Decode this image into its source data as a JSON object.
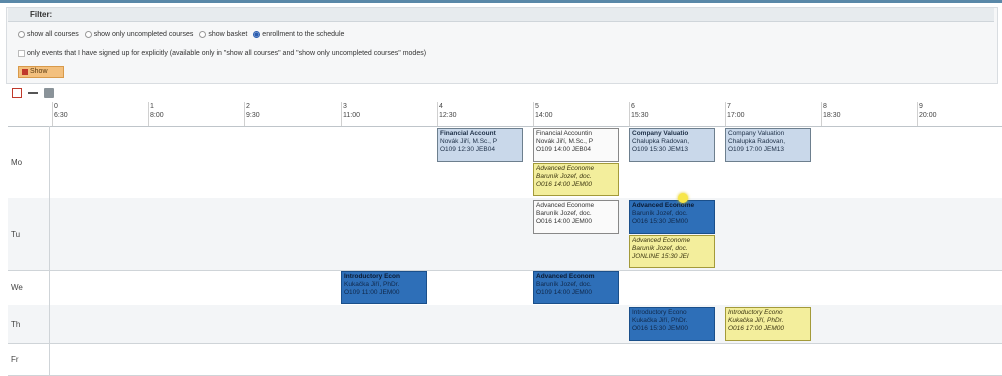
{
  "filter": {
    "title": "Filter:",
    "options": [
      {
        "label": "show all courses",
        "checked": false
      },
      {
        "label": "show only uncompleted courses",
        "checked": false
      },
      {
        "label": "show basket",
        "checked": false
      },
      {
        "label": "enrollment to the schedule",
        "checked": true
      }
    ],
    "only_events_label": "only events that I have signed up for explicitly (available only in \"show all courses\" and \"show only uncompleted courses\" modes)",
    "show_button": "Show"
  },
  "toolbar_icons": [
    "pdf-icon",
    "minus-icon",
    "print-icon"
  ],
  "timeline": [
    {
      "idx": "0",
      "time": "6:30"
    },
    {
      "idx": "1",
      "time": "8:00"
    },
    {
      "idx": "2",
      "time": "9:30"
    },
    {
      "idx": "3",
      "time": "11:00"
    },
    {
      "idx": "4",
      "time": "12:30"
    },
    {
      "idx": "5",
      "time": "14:00"
    },
    {
      "idx": "6",
      "time": "15:30"
    },
    {
      "idx": "7",
      "time": "17:00"
    },
    {
      "idx": "8",
      "time": "18:30"
    },
    {
      "idx": "9",
      "time": "20:00"
    }
  ],
  "days": [
    "Mo",
    "Tu",
    "We",
    "Th",
    "Fr"
  ],
  "events": {
    "mo_1": {
      "title": "Financial Account",
      "teacher": "Novák Jiří, M.Sc., P",
      "info": "O109 12:30 JEB04"
    },
    "mo_2": {
      "title": "Financial Accountin",
      "teacher": "Novák Jiří, M.Sc., P",
      "info": "O109 14:00 JEB04"
    },
    "mo_3": {
      "title": "Company Valuatio",
      "teacher": "Chalupka Radovan,",
      "info": "O109 15:30 JEM13"
    },
    "mo_4": {
      "title": "Company Valuation",
      "teacher": "Chalupka Radovan,",
      "info": "O109 17:00 JEM13"
    },
    "mo_5": {
      "title": "Advanced Econome",
      "teacher": "Baruník Jozef, doc.",
      "info": "O016 14:00 JEM00"
    },
    "tu_1": {
      "title": "Advanced Econome",
      "teacher": "Baruník Jozef, doc.",
      "info": "O016 14:00 JEM00"
    },
    "tu_2": {
      "title": "Advanced Econome",
      "teacher": "Baruník Jozef, doc.",
      "info": "O016 15:30 JEM00"
    },
    "tu_3": {
      "title": "Advanced Econome",
      "teacher": "Baruník Jozef, doc.",
      "info": "JONLINE 15:30 JEI"
    },
    "we_1": {
      "title": "Introductory Econ",
      "teacher": "Kukačka Jiří, PhDr.",
      "info": "O109 11:00 JEM00"
    },
    "we_2": {
      "title": "Advanced Econom",
      "teacher": "Baruník Jozef, doc.",
      "info": "O109 14:00 JEM00"
    },
    "th_1": {
      "title": "Introductory Econo",
      "teacher": "Kukačka Jiří, PhDr.",
      "info": "O016 15:30 JEM00"
    },
    "th_2": {
      "title": "Introductory Econo",
      "teacher": "Kukačka Jiří, PhDr.",
      "info": "O016 17:00 JEM00"
    }
  }
}
